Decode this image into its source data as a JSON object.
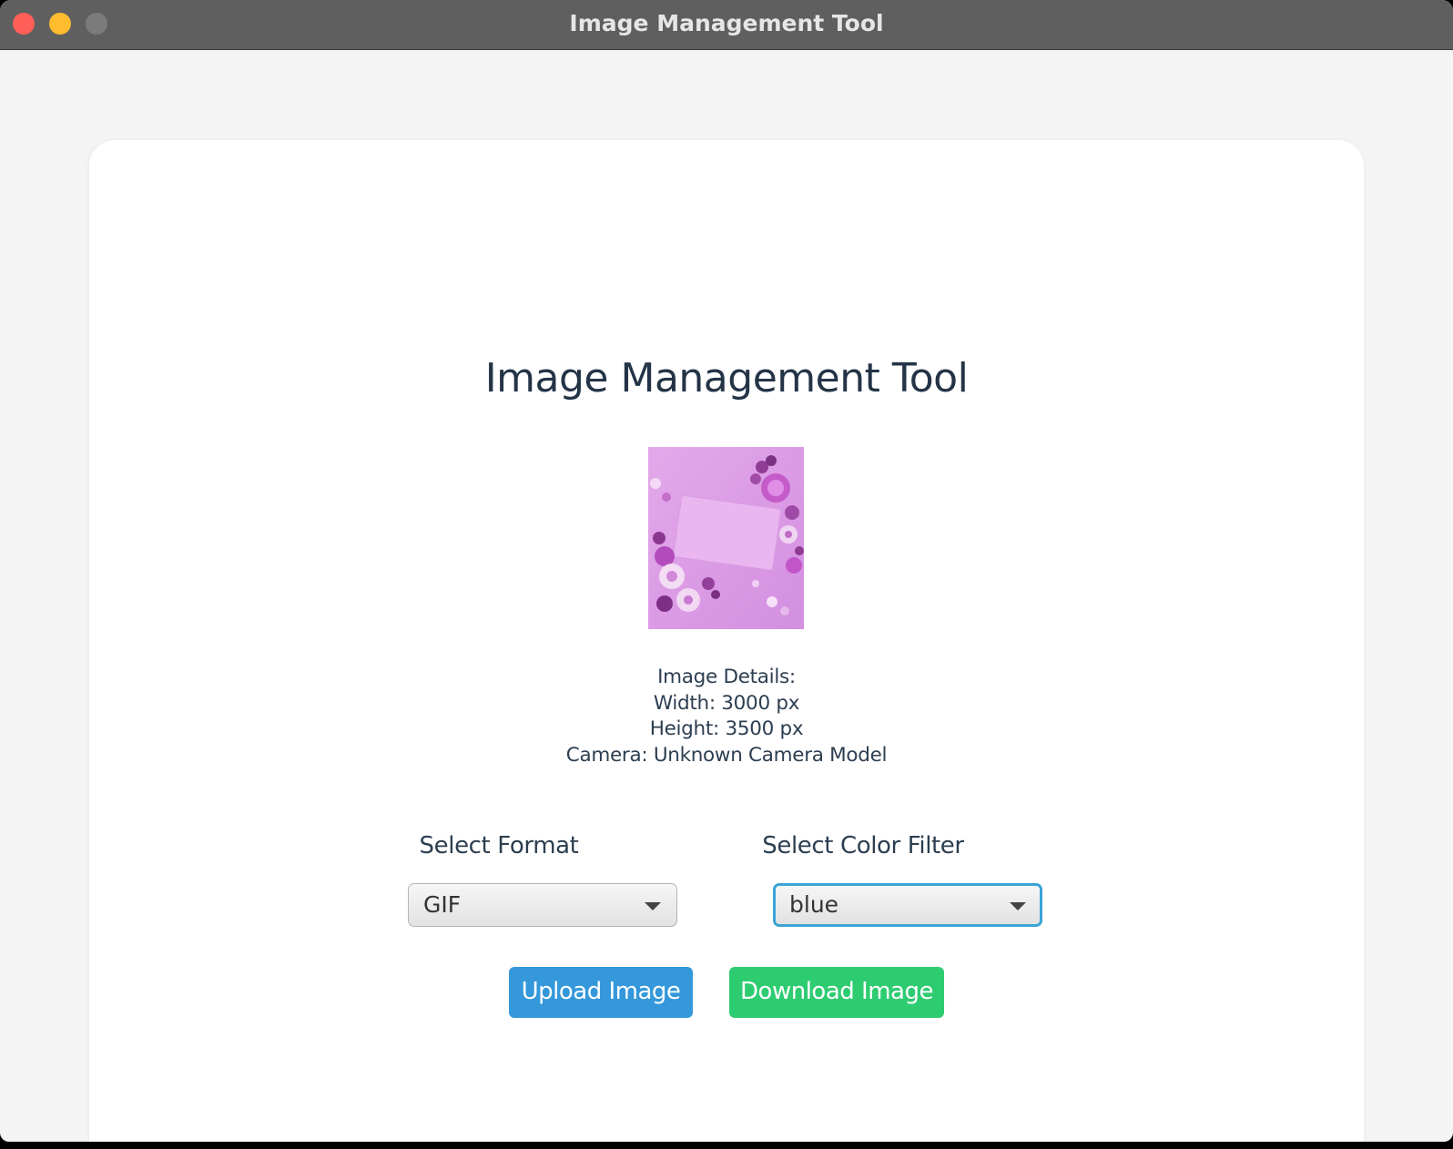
{
  "window": {
    "title": "Image Management Tool"
  },
  "main": {
    "heading": "Image Management Tool",
    "image_details": {
      "header": "Image Details:",
      "width": "Width: 3000 px",
      "height": "Height: 3500 px",
      "camera": "Camera: Unknown Camera Model"
    },
    "format": {
      "label": "Select Format",
      "selected": "GIF"
    },
    "color_filter": {
      "label": "Select Color Filter",
      "selected": "blue"
    },
    "buttons": {
      "upload": "Upload Image",
      "download": "Download Image"
    }
  },
  "colors": {
    "upload_button": "#3498db",
    "download_button": "#2ecc71",
    "focus_ring": "#3ba4d6",
    "text": "#2c3e50"
  }
}
